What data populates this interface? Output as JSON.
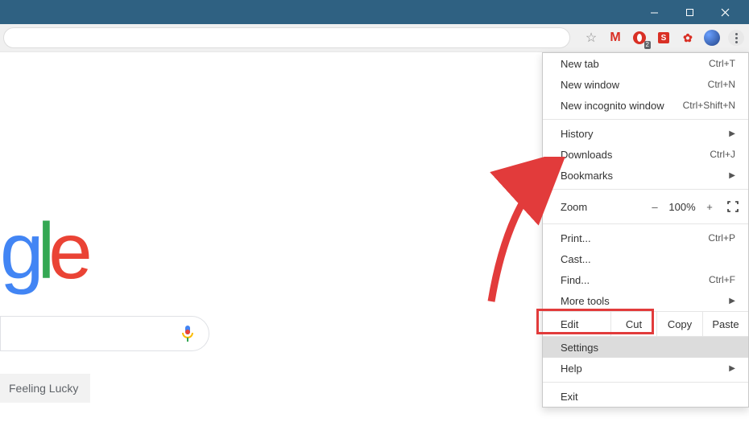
{
  "titlebar": {
    "minimize": "–",
    "maximize": "❐",
    "close": "✕"
  },
  "toolbar": {
    "star_icon": "star",
    "ext_opera_badge": "2",
    "ext_skype_s": "S",
    "ext_mystery": "⟳"
  },
  "content": {
    "logo_g": "g",
    "logo_l": "l",
    "logo_e": "e",
    "lucky_label": "Feeling Lucky"
  },
  "menu": {
    "new_tab": "New tab",
    "new_tab_sc": "Ctrl+T",
    "new_win": "New window",
    "new_win_sc": "Ctrl+N",
    "incog": "New incognito window",
    "incog_sc": "Ctrl+Shift+N",
    "history": "History",
    "downloads": "Downloads",
    "downloads_sc": "Ctrl+J",
    "bookmarks": "Bookmarks",
    "zoom_lbl": "Zoom",
    "zoom_minus": "–",
    "zoom_pct": "100%",
    "zoom_plus": "+",
    "print": "Print...",
    "print_sc": "Ctrl+P",
    "cast": "Cast...",
    "find": "Find...",
    "find_sc": "Ctrl+F",
    "moretools": "More tools",
    "edit": "Edit",
    "cut": "Cut",
    "copy": "Copy",
    "paste": "Paste",
    "settings": "Settings",
    "help": "Help",
    "exit": "Exit"
  }
}
